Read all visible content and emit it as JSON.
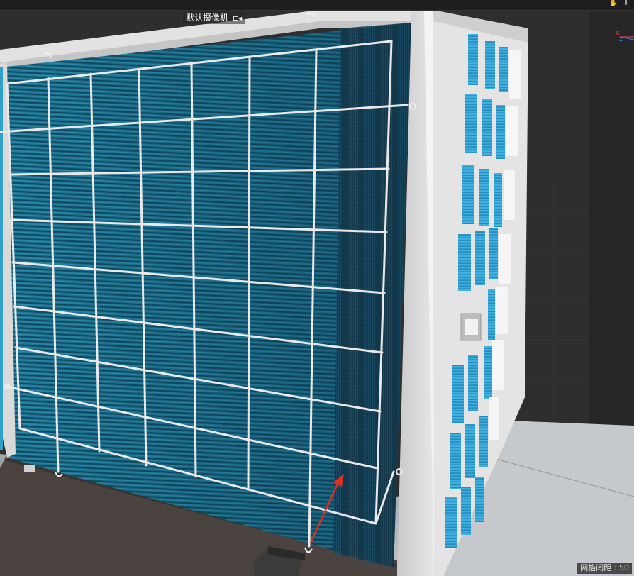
{
  "viewport": {
    "camera_label": "默认摄像机",
    "grid_status": "网格间距 : 50",
    "axis_labels": {
      "x": "x",
      "z": "z"
    }
  },
  "icons": {
    "camera_dropdown": "camera-menu-icon",
    "pan_tool": "hand-icon",
    "move_tool": "arrow-down-icon"
  },
  "colors": {
    "fin_blue": "#1c7d9b",
    "frame_white": "#dcdcdc",
    "annotation_arrow": "#e03020",
    "axis_x": "#e23a3a",
    "axis_z": "#3a6ee8"
  }
}
